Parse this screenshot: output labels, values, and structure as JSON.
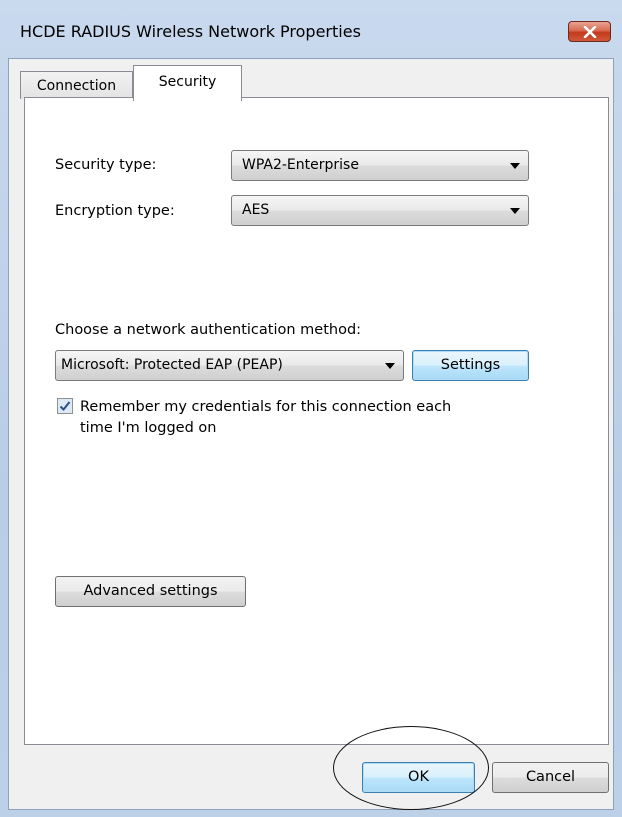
{
  "window": {
    "title": "HCDE RADIUS Wireless Network Properties"
  },
  "tabs": [
    {
      "label": "Connection",
      "active": false
    },
    {
      "label": "Security",
      "active": true
    }
  ],
  "security": {
    "security_type_label": "Security type:",
    "security_type_value": "WPA2-Enterprise",
    "encryption_type_label": "Encryption type:",
    "encryption_type_value": "AES",
    "auth_method_label": "Choose a network authentication method:",
    "auth_method_value": "Microsoft: Protected EAP (PEAP)",
    "settings_label": "Settings",
    "remember_label_line1": "Remember my credentials for this connection each",
    "remember_label_line2": "time I'm logged on",
    "remember_checked": true,
    "advanced_label": "Advanced settings"
  },
  "footer": {
    "ok_label": "OK",
    "cancel_label": "Cancel"
  },
  "colors": {
    "accent_focus": "#3c7fb1",
    "close_red": "#c23a1c"
  }
}
